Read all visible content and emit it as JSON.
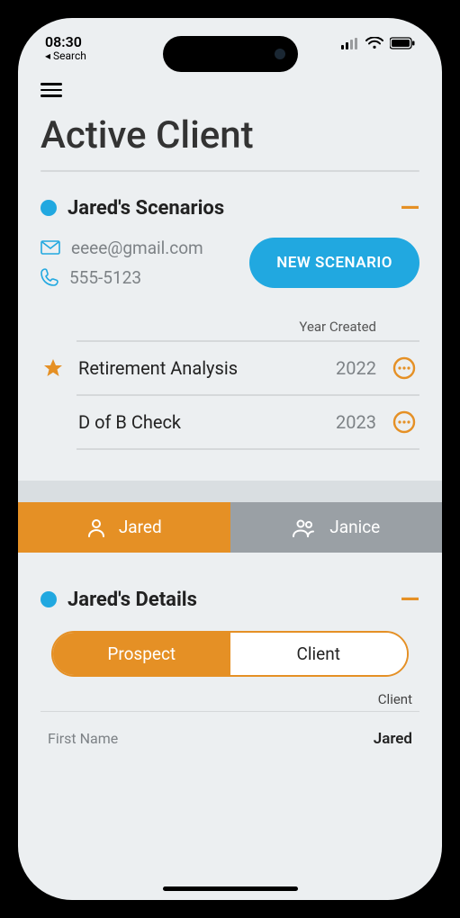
{
  "status": {
    "time": "08:30",
    "back_label": "◂ Search"
  },
  "page": {
    "title": "Active Client"
  },
  "scenarios": {
    "title": "Jared's Scenarios",
    "email": "eeee@gmail.com",
    "phone": "555-5123",
    "new_button": "NEW SCENARIO",
    "year_header": "Year Created",
    "rows": [
      {
        "name": "Retirement Analysis",
        "year": "2022",
        "starred": true
      },
      {
        "name": "D of B Check",
        "year": "2023",
        "starred": false
      }
    ]
  },
  "people_tabs": {
    "primary": {
      "label": "Jared"
    },
    "secondary": {
      "label": "Janice"
    }
  },
  "details": {
    "title": "Jared's Details",
    "segments": {
      "prospect": "Prospect",
      "client": "Client"
    },
    "active_segment": "prospect",
    "subheader": "Client",
    "fields": [
      {
        "label": "First Name",
        "value": "Jared"
      }
    ]
  }
}
